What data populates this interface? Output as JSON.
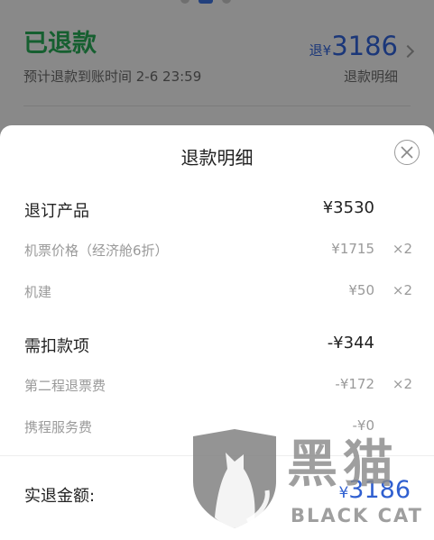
{
  "background": {
    "status": "已退款",
    "eta": "预计退款到账时间 2-6 23:59",
    "amount_prefix": "退",
    "currency": "¥",
    "amount": "3186",
    "detail_link": "退款明细"
  },
  "sheet": {
    "title": "退款明细",
    "rows": [
      {
        "label": "退订产品",
        "value": "¥3530",
        "qty": ""
      },
      {
        "label": "机票价格（经济舱6折）",
        "value": "¥1715",
        "qty": "×2"
      },
      {
        "label": "机建",
        "value": "¥50",
        "qty": "×2"
      },
      {
        "label": "需扣款项",
        "value": "-¥344",
        "qty": ""
      },
      {
        "label": "第二程退票费",
        "value": "-¥172",
        "qty": "×2"
      },
      {
        "label": "携程服务费",
        "value": "-¥0",
        "qty": ""
      }
    ],
    "total_label": "实退金额:",
    "total_currency": "¥",
    "total_amount": "3186"
  },
  "watermark": {
    "cn": "黑猫",
    "en": "BLACK CAT"
  },
  "colors": {
    "accent": "#2f5fd0",
    "success": "#27a454"
  }
}
